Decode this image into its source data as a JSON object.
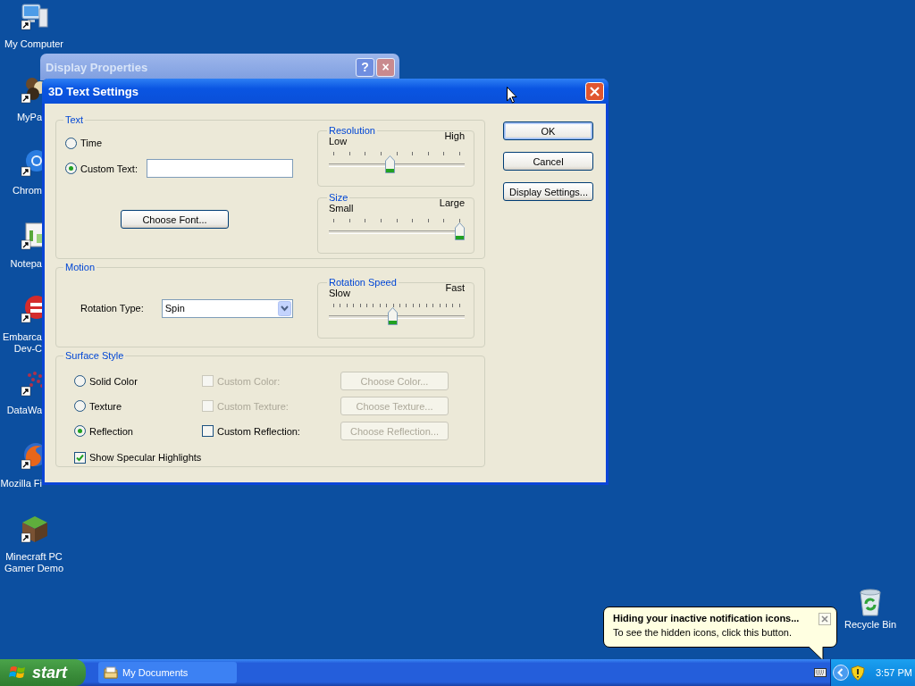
{
  "desktop_icons": [
    {
      "label": "My Computer"
    },
    {
      "label": "MyPa"
    },
    {
      "label": "Chrom"
    },
    {
      "label": "Notepa"
    },
    {
      "label": "Embarca Dev-C"
    },
    {
      "label": "DataWa"
    },
    {
      "label": "Mozilla Fi"
    },
    {
      "label": "Minecraft PC Gamer Demo"
    }
  ],
  "recycle_bin": {
    "label": "Recycle Bin"
  },
  "background_window": {
    "title": "Display Properties",
    "buttons": [
      "?",
      "×"
    ]
  },
  "dialog": {
    "title": "3D Text Settings",
    "text_group": {
      "title": "Text",
      "options": [
        {
          "label": "Time",
          "selected": false
        },
        {
          "label": "Custom Text:",
          "selected": true
        }
      ],
      "font_button": "Choose Font...",
      "resolution": {
        "title": "Resolution",
        "min_label": "Low",
        "max_label": "High",
        "level": 0.45
      },
      "size": {
        "title": "Size",
        "min_label": "Small",
        "max_label": "Large",
        "level": 1
      }
    },
    "motion_group": {
      "title": "Motion",
      "rotation_type_label": "Rotation Type:",
      "rotation_type": "Spin",
      "rotation_speed": {
        "title": "Rotation Speed",
        "min_label": "Slow",
        "max_label": "Fast",
        "level": 0.47
      }
    },
    "surface_group": {
      "title": "Surface Style",
      "rows": [
        {
          "option": {
            "label": "Solid Color",
            "selected": false
          },
          "custom": {
            "label": "Custom Color:",
            "checked": false,
            "disabled": true
          },
          "button": {
            "label": "Choose Color...",
            "disabled": true
          }
        },
        {
          "option": {
            "label": "Texture",
            "selected": false
          },
          "custom": {
            "label": "Custom Texture:",
            "checked": false,
            "disabled": true
          },
          "button": {
            "label": "Choose Texture...",
            "disabled": true
          }
        },
        {
          "option": {
            "label": "Reflection",
            "selected": true
          },
          "custom": {
            "label": "Custom Reflection:",
            "checked": false,
            "disabled": false
          },
          "button": {
            "label": "Choose Reflection...",
            "disabled": true
          }
        }
      ],
      "specular": {
        "label": "Show Specular Highlights",
        "checked": true
      }
    },
    "buttons": [
      "OK",
      "Cancel",
      "Display Settings..."
    ]
  },
  "balloon": {
    "title": "Hiding your inactive notification icons...",
    "body": "To see the hidden icons, click this button."
  },
  "taskbar": {
    "start": "start",
    "tasks": [
      {
        "label": "My Documents"
      }
    ],
    "clock": "3:57 PM"
  }
}
